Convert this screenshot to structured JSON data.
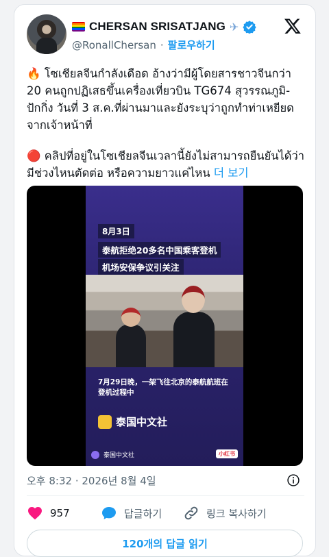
{
  "author": {
    "name": "CHERSAN SRISATJANG",
    "handle": "@RonallChersan",
    "follow_label": "팔로우하기",
    "separator": "·"
  },
  "tweet": {
    "paragraph1": "🔥 โซเชียลจีนกำลังเดือด อ้างว่ามีผู้โดยสารชาวจีนกว่า 20 คนถูกปฏิเสธขึ้นเครื่องเที่ยวบิน TG674 สุวรรณภูมิ-ปักกิ่ง วันที่ 3 ส.ค.ที่ผ่านมาและยังระบุว่าถูกทำท่าเหยียดจากเจ้าหน้าที่",
    "paragraph2": "🔴 คลิปที่อยู่ในโซเชียลจีนเวลานี้ยังไม่สามารถยืนยันได้ว่ามีช่วงไหนตัดต่อ หรือความยาวแค่ไหน",
    "more_label": "더 보기",
    "timestamp": "오후 8:32 · 2026년 8월 4일"
  },
  "video": {
    "date": "8月3日",
    "headline1": "泰航拒绝20多名中国乘客登机",
    "headline2": "机场安保争议引关注",
    "subtitle": "7月29日晚，一架飞往北京的泰航航班在登机过程中",
    "brand": "泰国中文社",
    "footer_account": "泰国中文社",
    "watermark": "小红书"
  },
  "actions": {
    "like_count": "957",
    "reply_label": "답글하기",
    "copy_link_label": "링크 복사하기",
    "read_replies_label": "120개의 답글 읽기"
  },
  "colors": {
    "accent": "#1d9bf0",
    "like": "#f91880",
    "text": "#0f1419",
    "secondary": "#536471"
  },
  "icons": [
    "rainbow-flag-icon",
    "airplane-icon",
    "verified-badge-icon",
    "x-logo-icon",
    "info-icon",
    "heart-icon",
    "reply-bubble-icon",
    "link-icon"
  ]
}
